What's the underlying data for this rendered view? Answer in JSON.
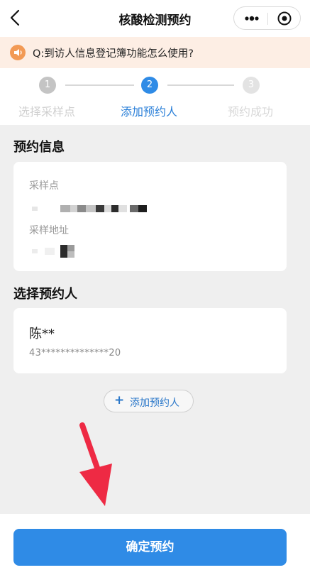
{
  "header": {
    "title": "核酸检测预约",
    "back_icon": "chevron-left-icon",
    "more_icon": "more-dots-icon",
    "close_icon": "target-circle-icon"
  },
  "notice": {
    "icon": "speaker-icon",
    "text": "Q:到访人信息登记簿功能怎么使用?"
  },
  "steps": [
    {
      "number": "1",
      "label": "选择采样点",
      "state": "done"
    },
    {
      "number": "2",
      "label": "添加预约人",
      "state": "active"
    },
    {
      "number": "3",
      "label": "预约成功",
      "state": "pending"
    }
  ],
  "appointment_info": {
    "section_title": "预约信息",
    "site_label": "采样点",
    "address_label": "采样地址"
  },
  "select_person": {
    "section_title": "选择预约人",
    "person_name": "陈**",
    "person_id": "43**************20",
    "add_button_label": "添加预约人"
  },
  "confirm_button_label": "确定预约",
  "colors": {
    "accent": "#2f8be6",
    "notice_bg": "#fdeee4",
    "arrow": "#ee2a44"
  }
}
